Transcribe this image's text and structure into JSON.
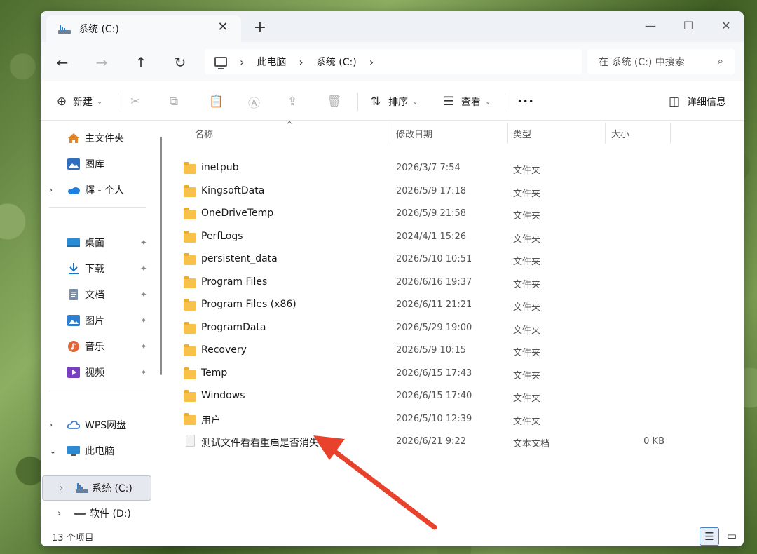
{
  "window": {
    "tab_title": "系统 (C:)",
    "tab_close": "✕",
    "new_tab": "+",
    "minimize": "—",
    "maximize": "☐",
    "close": "✕"
  },
  "nav": {
    "back": "←",
    "forward": "→",
    "up": "↑",
    "refresh": "↻"
  },
  "address": {
    "crumbs": [
      "此电脑",
      "系统 (C:)"
    ],
    "separator": "›"
  },
  "search": {
    "placeholder": "在 系统 (C:) 中搜索",
    "icon": "⌕"
  },
  "toolbar": {
    "new_label": "新建",
    "sort_label": "排序",
    "view_label": "查看",
    "more_label": "•••",
    "details_label": "详细信息",
    "caret": "⌄"
  },
  "sidebar": {
    "pin": "📌",
    "items": [
      {
        "label": "主文件夹",
        "icon": "home-icon",
        "color": "#e0862f"
      },
      {
        "label": "图库",
        "icon": "gallery-icon",
        "color": "#2f6fbe"
      },
      {
        "label": "辉 - 个人",
        "icon": "onedrive-icon",
        "color": "#1f80e0"
      },
      {
        "label": "桌面",
        "icon": "desktop-icon",
        "color": "#2a8bd6"
      },
      {
        "label": "下载",
        "icon": "download-icon",
        "color": "#1a73c9"
      },
      {
        "label": "文档",
        "icon": "documents-icon",
        "color": "#7b8fa8"
      },
      {
        "label": "图片",
        "icon": "pictures-icon",
        "color": "#2f7fd1"
      },
      {
        "label": "音乐",
        "icon": "music-icon",
        "color": "#e0673a"
      },
      {
        "label": "视频",
        "icon": "videos-icon",
        "color": "#7a3fbf"
      },
      {
        "label": "WPS网盘",
        "icon": "wps-cloud-icon",
        "color": "#3d7fd9"
      },
      {
        "label": "此电脑",
        "icon": "this-pc-icon",
        "color": "#2c8ad3"
      },
      {
        "label": "系统 (C:)",
        "icon": "drive-c-icon",
        "color": "#4a7ab8"
      },
      {
        "label": "软件 (D:)",
        "icon": "drive-d-icon",
        "color": "#555555"
      }
    ]
  },
  "columns": {
    "name": "名称",
    "date": "修改日期",
    "type": "类型",
    "size": "大小",
    "sort_caret": "^"
  },
  "files": [
    {
      "name": "inetpub",
      "date": "2026/3/7 7:54",
      "type": "文件夹",
      "size": ""
    },
    {
      "name": "KingsoftData",
      "date": "2026/5/9 17:18",
      "type": "文件夹",
      "size": ""
    },
    {
      "name": "OneDriveTemp",
      "date": "2026/5/9 21:58",
      "type": "文件夹",
      "size": ""
    },
    {
      "name": "PerfLogs",
      "date": "2024/4/1 15:26",
      "type": "文件夹",
      "size": ""
    },
    {
      "name": "persistent_data",
      "date": "2026/5/10 10:51",
      "type": "文件夹",
      "size": ""
    },
    {
      "name": "Program Files",
      "date": "2026/6/16 19:37",
      "type": "文件夹",
      "size": ""
    },
    {
      "name": "Program Files (x86)",
      "date": "2026/6/11 21:21",
      "type": "文件夹",
      "size": ""
    },
    {
      "name": "ProgramData",
      "date": "2026/5/29 19:00",
      "type": "文件夹",
      "size": ""
    },
    {
      "name": "Recovery",
      "date": "2026/5/9 10:15",
      "type": "文件夹",
      "size": ""
    },
    {
      "name": "Temp",
      "date": "2026/6/15 17:43",
      "type": "文件夹",
      "size": ""
    },
    {
      "name": "Windows",
      "date": "2026/6/15 17:40",
      "type": "文件夹",
      "size": ""
    },
    {
      "name": "用户",
      "date": "2026/5/10 12:39",
      "type": "文件夹",
      "size": ""
    },
    {
      "name": "测试文件看看重启是否消失.txt",
      "date": "2026/6/21 9:22",
      "type": "文本文档",
      "size": "0 KB"
    }
  ],
  "status": {
    "count": "13 个项目"
  },
  "colors": {
    "folder": "#f7c14a",
    "accent": "#4a7fc1",
    "annotation_arrow": "#e8412c"
  }
}
